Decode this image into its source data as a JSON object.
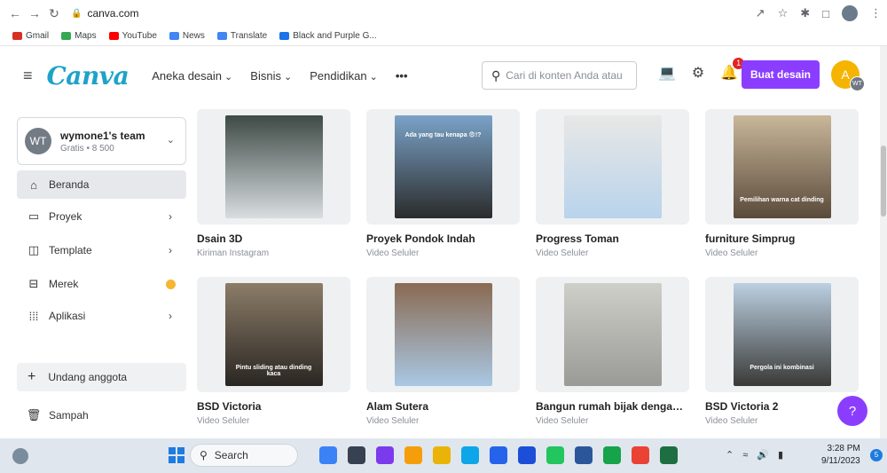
{
  "browser": {
    "url": "canva.com",
    "bookmarks": [
      {
        "label": "Gmail",
        "color": "#d93025"
      },
      {
        "label": "Maps",
        "color": "#34a853"
      },
      {
        "label": "YouTube",
        "color": "#ff0000"
      },
      {
        "label": "News",
        "color": "#4285f4"
      },
      {
        "label": "Translate",
        "color": "#4285f4"
      },
      {
        "label": "Black and Purple G...",
        "color": "#1a73e8"
      }
    ]
  },
  "header": {
    "logo": "Canva",
    "nav": [
      "Aneka desain",
      "Bisnis",
      "Pendidikan"
    ],
    "more": "•••",
    "search_placeholder": "Cari di konten Anda atau",
    "notification_count": "1",
    "create_label": "Buat desain",
    "avatar_letter": "A",
    "avatar_sub": "WT"
  },
  "sidebar": {
    "team": {
      "initials": "WT",
      "name": "wymone1's team",
      "meta": "Gratis • 8 500"
    },
    "items": [
      {
        "label": "Beranda",
        "icon": "home-icon",
        "glyph": "⌂",
        "chevron": ""
      },
      {
        "label": "Proyek",
        "icon": "folder-icon",
        "glyph": "▭",
        "chevron": "›"
      },
      {
        "label": "Template",
        "icon": "template-icon",
        "glyph": "◫",
        "chevron": "›"
      },
      {
        "label": "Merek",
        "icon": "brand-icon",
        "glyph": "⊟",
        "chevron": ""
      },
      {
        "label": "Aplikasi",
        "icon": "apps-icon",
        "glyph": "⁞⁞⁞",
        "chevron": "›"
      }
    ],
    "invite_label": "Undang anggota",
    "trash_label": "Sampah"
  },
  "designs": [
    {
      "title": "Dsain 3D",
      "sub": "Kiriman Instagram",
      "overlay": "",
      "c1": "#d9dde0",
      "c2": "#3e4a45"
    },
    {
      "title": "Proyek Pondok Indah",
      "sub": "Video Seluler",
      "overlay": "Ada yang tau kenapa 😨!?",
      "c1": "#2b2b2b",
      "c2": "#7aa3c8"
    },
    {
      "title": "Progress Toman",
      "sub": "Video Seluler",
      "overlay": "",
      "c1": "#b9d3ec",
      "c2": "#e8e8e6"
    },
    {
      "title": "furniture Simprug",
      "sub": "Video Seluler",
      "overlay": "Pemilihan warna cat dinding",
      "c1": "#5a4a3a",
      "c2": "#c9b79a"
    },
    {
      "title": "BSD Victoria",
      "sub": "Video Seluler",
      "overlay": "Pintu sliding atau dinding kaca",
      "c1": "#2a2622",
      "c2": "#8c7d68"
    },
    {
      "title": "Alam Sutera",
      "sub": "Video Seluler",
      "overlay": "",
      "c1": "#a9c8e4",
      "c2": "#8a6a52"
    },
    {
      "title": "Bangun rumah bijak dengan ko...",
      "sub": "Video Seluler",
      "overlay": "",
      "c1": "#9a9a96",
      "c2": "#cfcfca"
    },
    {
      "title": "BSD Victoria 2",
      "sub": "Video Seluler",
      "overlay": "Pergola ini kombinasi",
      "c1": "#3a3a38",
      "c2": "#bcd0e2"
    }
  ],
  "help_label": "?",
  "taskbar": {
    "search_label": "Search",
    "apps": [
      "#3b82f6",
      "#374151",
      "#7c3aed",
      "#f59e0b",
      "#eab308",
      "#0ea5e9",
      "#2563eb",
      "#1d4ed8",
      "#22c55e",
      "#2b579a",
      "#16a34a",
      "#ea4335",
      "#1d6f42"
    ],
    "time": "3:28 PM",
    "date": "9/11/2023",
    "notif_count": "5"
  }
}
